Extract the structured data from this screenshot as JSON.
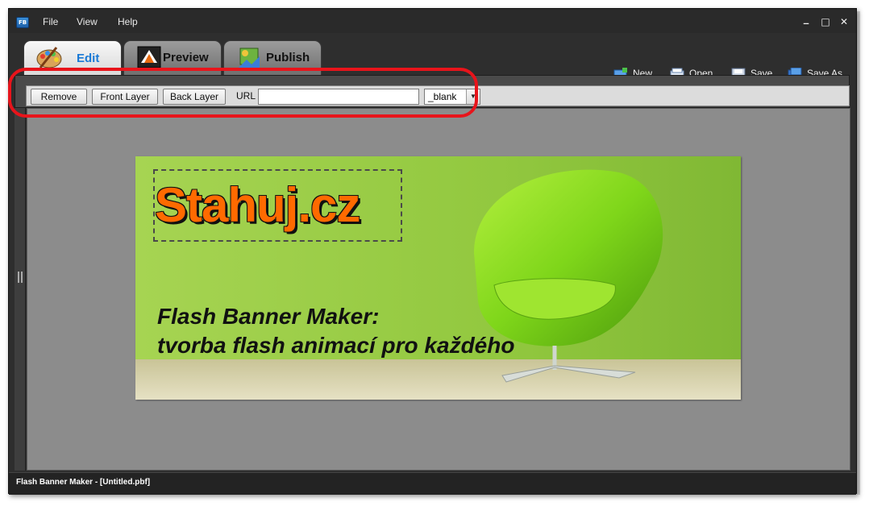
{
  "app": {
    "icon_text": "FB",
    "status": "Flash Banner Maker - [Untitled.pbf]"
  },
  "menu": {
    "file": "File",
    "view": "View",
    "help": "Help"
  },
  "window_controls": {
    "minimize": "_",
    "maximize": "□",
    "close": "✕"
  },
  "tabs": [
    {
      "label": "Edit",
      "icon": "palette-icon",
      "active": true
    },
    {
      "label": "Preview",
      "icon": "preview-icon",
      "active": false
    },
    {
      "label": "Publish",
      "icon": "publish-icon",
      "active": false
    }
  ],
  "toolbar": {
    "new": "New",
    "open": "Open",
    "save": "Save",
    "save_as": "Save As"
  },
  "properties": {
    "remove": "Remove",
    "front_layer": "Front Layer",
    "back_layer": "Back Layer",
    "url_label": "URL",
    "url_value": "",
    "target": "_blank"
  },
  "banner": {
    "logo_text": "Stahuj.cz",
    "headline_line1": "Flash Banner Maker:",
    "headline_line2": "tvorba flash animací pro každého"
  },
  "colors": {
    "accent": "#1a7ad6",
    "highlight": "#e8141b",
    "logo": "#ff6a00",
    "banner_bg": "#9bd049"
  }
}
